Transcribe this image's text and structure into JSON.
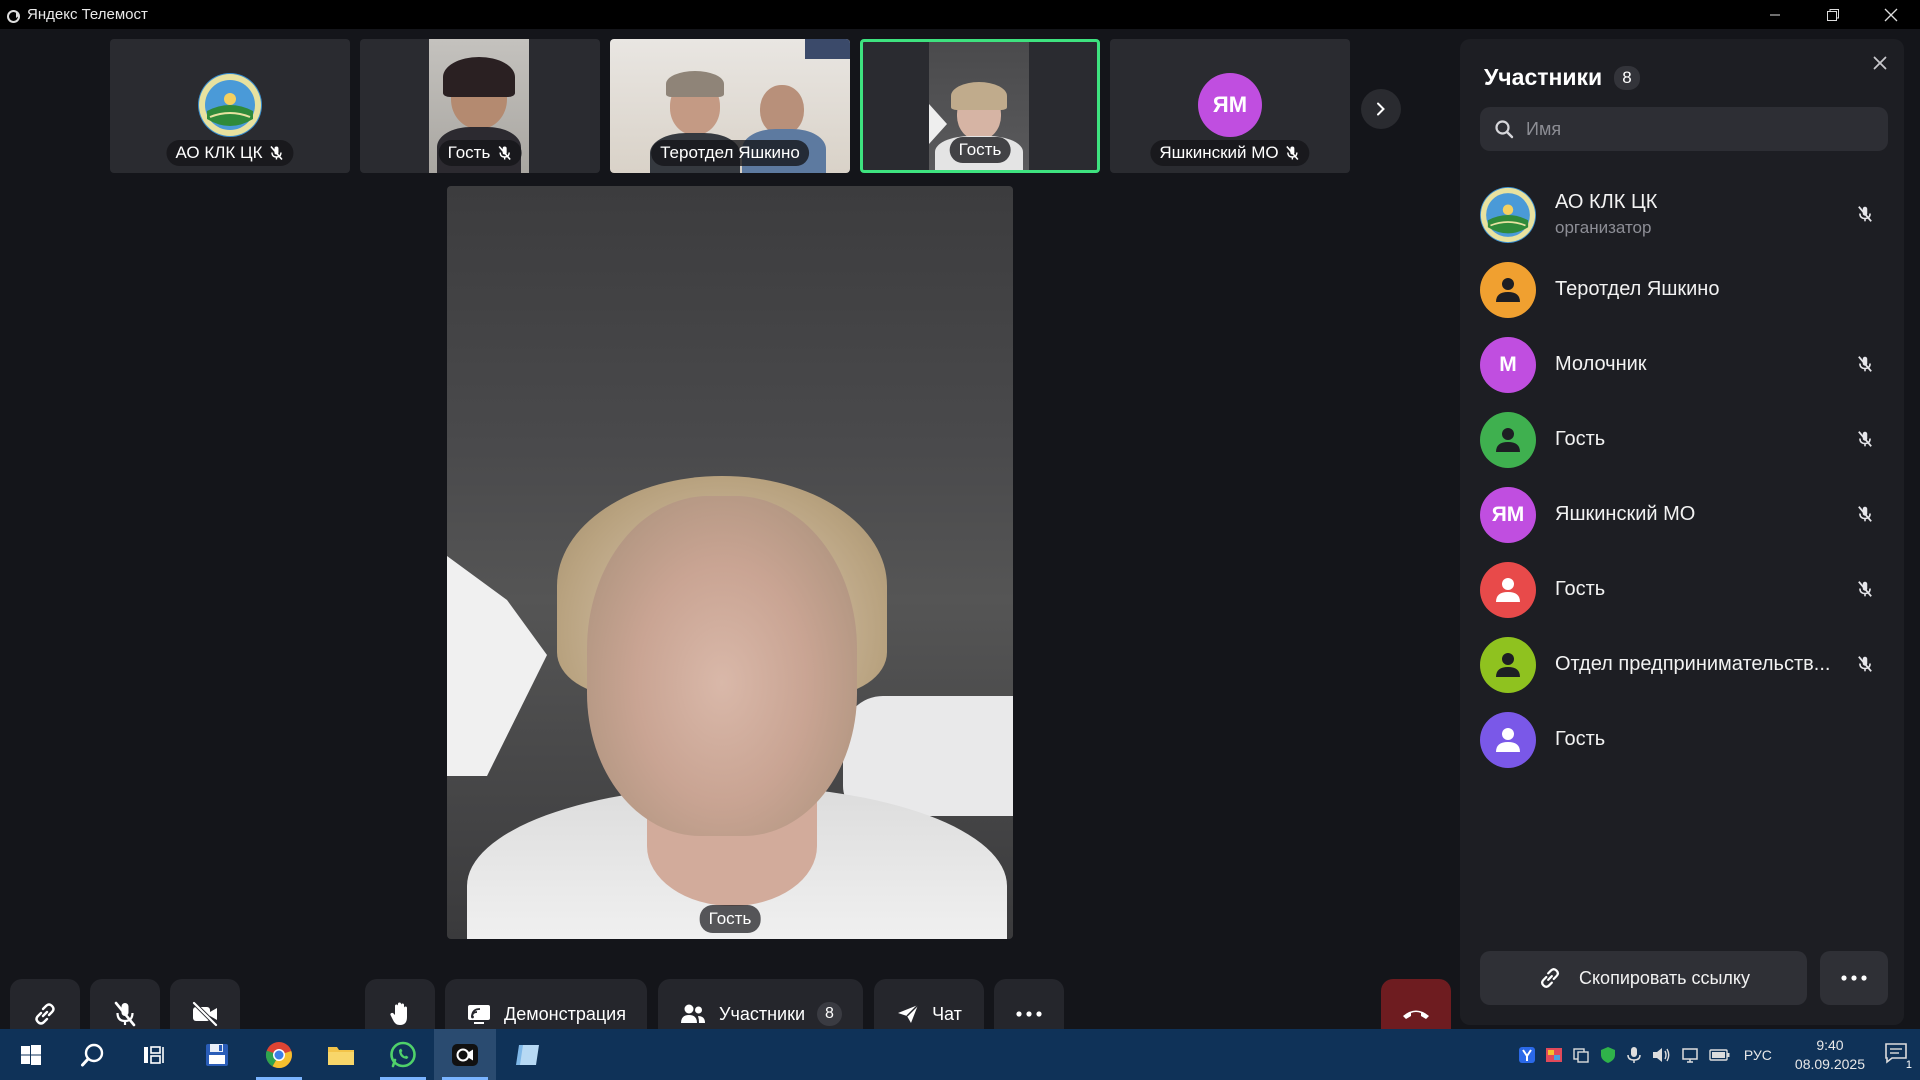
{
  "window": {
    "title": "Яндекс Телемост"
  },
  "thumbnails": [
    {
      "name": "АО КЛК ЦК",
      "muted": true,
      "kind": "logo"
    },
    {
      "name": "Гость",
      "muted": true,
      "kind": "video"
    },
    {
      "name": "Теротдел Яшкино",
      "muted": false,
      "kind": "video"
    },
    {
      "name": "Гость",
      "muted": false,
      "kind": "video",
      "active": true
    },
    {
      "name": "Яшкинский МО",
      "muted": true,
      "kind": "initials",
      "initials": "ЯМ",
      "color": "#c04ee0"
    }
  ],
  "main_video": {
    "name": "Гость"
  },
  "controls": {
    "demo_label": "Демонстрация",
    "participants_label": "Участники",
    "participants_count": "8",
    "chat_label": "Чат"
  },
  "panel": {
    "title": "Участники",
    "count": "8",
    "search_placeholder": "Имя",
    "participants": [
      {
        "name": "АО КЛК ЦК",
        "role": "организатор",
        "avatar": "logo",
        "muted": true
      },
      {
        "name": "Теротдел Яшкино",
        "role": "",
        "avatar": "person",
        "color": "#f0a030",
        "muted": false
      },
      {
        "name": "Молочник",
        "role": "",
        "avatar": "letter",
        "initials": "М",
        "color": "#c04ee0",
        "muted": true
      },
      {
        "name": "Гость",
        "role": "",
        "avatar": "person",
        "color": "#3fb04f",
        "muted": true
      },
      {
        "name": "Яшкинский МО",
        "role": "",
        "avatar": "letter",
        "initials": "ЯМ",
        "color": "#c04ee0",
        "muted": true
      },
      {
        "name": "Гость",
        "role": "",
        "avatar": "person",
        "color": "#e84a4a",
        "muted": true
      },
      {
        "name": "Отдел предпринимательств...",
        "role": "",
        "avatar": "person",
        "color": "#8fc21f",
        "muted": true
      },
      {
        "name": "Гость",
        "role": "",
        "avatar": "person",
        "color": "#7a58e8",
        "muted": false
      }
    ],
    "copy_link_label": "Скопировать ссылку"
  },
  "taskbar": {
    "language": "РУС",
    "time": "9:40",
    "date": "08.09.2025",
    "notifications": "1"
  },
  "colors": {
    "active_speaker": "#3ee27f",
    "hangup": "#6e1c20",
    "taskbar": "#0f3258"
  }
}
